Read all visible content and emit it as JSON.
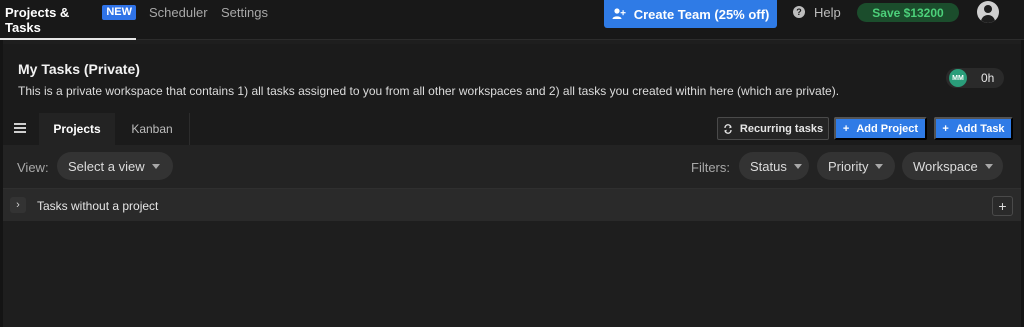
{
  "topnav": {
    "active_tab": "Projects & Tasks",
    "new_badge": "NEW",
    "scheduler": "Scheduler",
    "settings": "Settings",
    "create_team": "Create Team (25% off)",
    "help": "Help",
    "save": "Save $13200"
  },
  "workspace": {
    "title": "My Tasks (Private)",
    "description": "This is a private workspace that contains 1) all tasks assigned to you from all other workspaces and 2) all tasks you created within here (which are private).",
    "avatar_initials": "MM",
    "timer": "0h"
  },
  "tabs": {
    "projects": "Projects",
    "kanban": "Kanban",
    "recurring": "Recurring tasks",
    "add_project": "Add Project",
    "add_task": "Add Task"
  },
  "filters": {
    "view_label": "View:",
    "select_view": "Select a view",
    "filters_label": "Filters:",
    "status": "Status",
    "priority": "Priority",
    "workspace": "Workspace"
  },
  "groups": [
    {
      "label": "Tasks without a project"
    }
  ],
  "colors": {
    "accent": "#2f7be6",
    "save_text": "#4cd07a",
    "save_bg": "#1b4d2c",
    "avatar_mm": "#2a9d7a"
  }
}
